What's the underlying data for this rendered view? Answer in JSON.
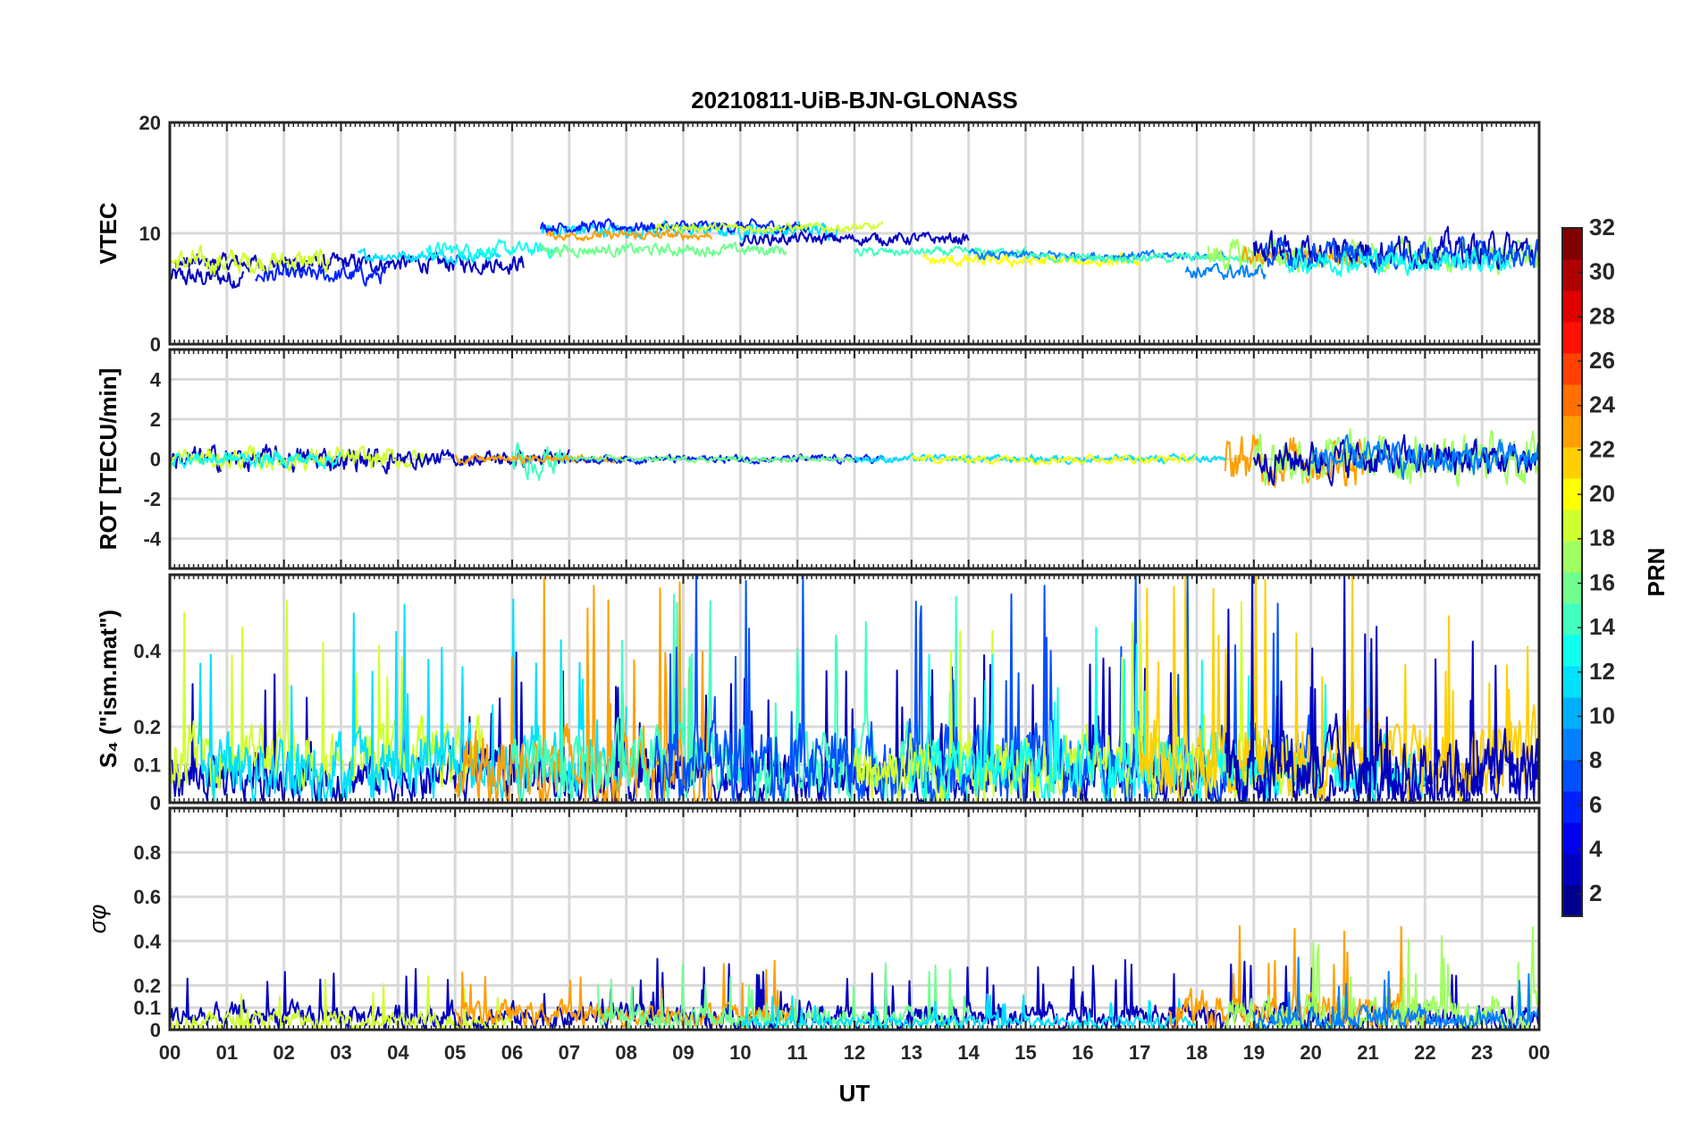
{
  "chart_data": {
    "title": "20210811-UiB-BJN-GLONASS",
    "type": "line",
    "xlabel": "UT",
    "x_tick_labels": [
      "00",
      "01",
      "02",
      "03",
      "04",
      "05",
      "06",
      "07",
      "08",
      "09",
      "10",
      "11",
      "12",
      "13",
      "14",
      "15",
      "16",
      "17",
      "18",
      "19",
      "20",
      "21",
      "22",
      "23",
      "00"
    ],
    "xlim_hours": [
      0,
      24
    ],
    "grid": true,
    "colorbar": {
      "label": "PRN",
      "range": [
        1,
        32
      ],
      "ticks": [
        "2",
        "4",
        "6",
        "8",
        "10",
        "12",
        "14",
        "16",
        "18",
        "20",
        "22",
        "24",
        "26",
        "28",
        "30",
        "32"
      ],
      "colormap": "jet",
      "colors": [
        "#00008f",
        "#0000bf",
        "#0000ef",
        "#0020ff",
        "#0050ff",
        "#0080ff",
        "#00b0ff",
        "#00e0ff",
        "#10ffef",
        "#40ffbf",
        "#70ff8f",
        "#a0ff60",
        "#d0ff30",
        "#ffff00",
        "#ffcf00",
        "#ff9f00",
        "#ff7000",
        "#ff4000",
        "#ff1000",
        "#df0000",
        "#af0000",
        "#800000"
      ]
    },
    "panels": [
      {
        "id": "vtec",
        "ylabel": "VTEC",
        "ylim": [
          0,
          20
        ],
        "yticks": [
          "0",
          "10",
          "20"
        ],
        "segments": [
          {
            "prn": 2,
            "t": [
              0.0,
              1.3
            ],
            "base": 6.0,
            "noise": 0.7
          },
          {
            "prn": 3,
            "t": [
              0.1,
              6.2
            ],
            "base": 7.3,
            "noise": 0.6
          },
          {
            "prn": 19,
            "t": [
              0.0,
              2.8
            ],
            "base": 7.4,
            "noise": 0.8
          },
          {
            "prn": 6,
            "t": [
              1.5,
              3.8
            ],
            "base": 6.2,
            "noise": 0.6
          },
          {
            "prn": 11,
            "t": [
              3.3,
              5.8
            ],
            "base": 8.0,
            "noise": 0.4
          },
          {
            "prn": 13,
            "t": [
              4.5,
              6.8
            ],
            "base": 8.5,
            "noise": 0.5
          },
          {
            "prn": 12,
            "t": [
              6.5,
              11.7
            ],
            "base": 10.3,
            "noise": 0.5
          },
          {
            "prn": 5,
            "t": [
              6.5,
              11.2
            ],
            "base": 10.6,
            "noise": 0.4
          },
          {
            "prn": 16,
            "t": [
              6.5,
              10.8
            ],
            "base": 8.5,
            "noise": 0.4
          },
          {
            "prn": 23,
            "t": [
              6.6,
              9.5
            ],
            "base": 9.8,
            "noise": 0.3
          },
          {
            "prn": 18,
            "t": [
              8.5,
              12.5
            ],
            "base": 10.5,
            "noise": 0.3
          },
          {
            "prn": 2,
            "t": [
              10.0,
              14.0
            ],
            "base": 9.5,
            "noise": 0.4
          },
          {
            "prn": 14,
            "t": [
              12.0,
              15.0
            ],
            "base": 8.3,
            "noise": 0.3
          },
          {
            "prn": 20,
            "t": [
              13.2,
              17.0
            ],
            "base": 7.5,
            "noise": 0.4
          },
          {
            "prn": 8,
            "t": [
              14.0,
              18.5
            ],
            "base": 8.0,
            "noise": 0.3
          },
          {
            "prn": 15,
            "t": [
              15.0,
              19.0
            ],
            "base": 7.8,
            "noise": 0.3
          },
          {
            "prn": 9,
            "t": [
              17.8,
              19.2
            ],
            "base": 6.5,
            "noise": 0.5
          },
          {
            "prn": 17,
            "t": [
              18.2,
              24.0
            ],
            "base": 8.0,
            "noise": 1.0
          },
          {
            "prn": 23,
            "t": [
              18.8,
              21.0
            ],
            "base": 7.8,
            "noise": 0.6
          },
          {
            "prn": 2,
            "t": [
              19.0,
              24.0
            ],
            "base": 8.5,
            "noise": 1.1
          },
          {
            "prn": 7,
            "t": [
              19.2,
              24.0
            ],
            "base": 8.0,
            "noise": 0.9
          },
          {
            "prn": 13,
            "t": [
              19.5,
              23.5
            ],
            "base": 7.5,
            "noise": 0.8
          }
        ]
      },
      {
        "id": "rot",
        "ylabel": "ROT [TECU/min]",
        "ylim": [
          -5.5,
          5.5
        ],
        "yticks": [
          "-4",
          "-2",
          "0",
          "2",
          "4"
        ],
        "segments": [
          {
            "prn": 2,
            "t": [
              0.0,
              4.0
            ],
            "base": 0,
            "noise": 0.45
          },
          {
            "prn": 19,
            "t": [
              0.0,
              4.5
            ],
            "base": 0,
            "noise": 0.4
          },
          {
            "prn": 13,
            "t": [
              0.0,
              3.0
            ],
            "base": 0,
            "noise": 0.3
          },
          {
            "prn": 3,
            "t": [
              4.0,
              7.0
            ],
            "base": 0,
            "noise": 0.3
          },
          {
            "prn": 15,
            "t": [
              6.0,
              7.0
            ],
            "base": 0,
            "noise": 0.6
          },
          {
            "prn": 23,
            "t": [
              5.0,
              8.0
            ],
            "base": 0,
            "noise": 0.15
          },
          {
            "prn": 5,
            "t": [
              7.0,
              12.5
            ],
            "base": 0,
            "noise": 0.15
          },
          {
            "prn": 16,
            "t": [
              7.0,
              12.0
            ],
            "base": 0,
            "noise": 0.1
          },
          {
            "prn": 12,
            "t": [
              12.0,
              18.5
            ],
            "base": 0,
            "noise": 0.15
          },
          {
            "prn": 20,
            "t": [
              13.0,
              18.0
            ],
            "base": 0,
            "noise": 0.15
          },
          {
            "prn": 23,
            "t": [
              18.5,
              21.0
            ],
            "base": 0,
            "noise": 0.9
          },
          {
            "prn": 17,
            "t": [
              19.0,
              24.0
            ],
            "base": 0,
            "noise": 0.9
          },
          {
            "prn": 2,
            "t": [
              19.0,
              24.0
            ],
            "base": 0,
            "noise": 0.7
          },
          {
            "prn": 9,
            "t": [
              20.0,
              24.0
            ],
            "base": 0,
            "noise": 0.6
          }
        ]
      },
      {
        "id": "s4",
        "ylabel": "S₄ (\"ism.mat\")",
        "ylim": [
          0,
          0.6
        ],
        "yticks": [
          "0",
          "0.1",
          "0.2",
          "0.4"
        ],
        "segments": [
          {
            "prn": 2,
            "t": [
              0.0,
              24.0
            ],
            "base": 0.07,
            "noise": 0.05
          },
          {
            "prn": 19,
            "t": [
              0.0,
              5.5
            ],
            "base": 0.13,
            "noise": 0.06
          },
          {
            "prn": 11,
            "t": [
              0.5,
              8.0
            ],
            "base": 0.1,
            "noise": 0.07
          },
          {
            "prn": 23,
            "t": [
              5.0,
              9.5
            ],
            "base": 0.09,
            "noise": 0.08
          },
          {
            "prn": 15,
            "t": [
              6.0,
              14.0
            ],
            "base": 0.09,
            "noise": 0.07
          },
          {
            "prn": 7,
            "t": [
              8.5,
              20.0
            ],
            "base": 0.1,
            "noise": 0.08
          },
          {
            "prn": 18,
            "t": [
              12.0,
              20.0
            ],
            "base": 0.1,
            "noise": 0.07
          },
          {
            "prn": 13,
            "t": [
              13.0,
              22.0
            ],
            "base": 0.09,
            "noise": 0.06
          },
          {
            "prn": 21,
            "t": [
              17.0,
              24.0
            ],
            "base": 0.12,
            "noise": 0.08
          },
          {
            "prn": 3,
            "t": [
              18.5,
              24.0
            ],
            "base": 0.09,
            "noise": 0.08
          }
        ]
      },
      {
        "id": "sigma",
        "ylabel": "σφ",
        "ylim": [
          0,
          1.0
        ],
        "yticks": [
          "0",
          "0.1",
          "0.2",
          "0.4",
          "0.6",
          "0.8"
        ],
        "segments": [
          {
            "prn": 2,
            "t": [
              0.0,
              24.0
            ],
            "base": 0.06,
            "noise": 0.04
          },
          {
            "prn": 19,
            "t": [
              0.0,
              6.0
            ],
            "base": 0.04,
            "noise": 0.03
          },
          {
            "prn": 23,
            "t": [
              5.0,
              11.0
            ],
            "base": 0.07,
            "noise": 0.04
          },
          {
            "prn": 16,
            "t": [
              7.5,
              14.0
            ],
            "base": 0.05,
            "noise": 0.04
          },
          {
            "prn": 12,
            "t": [
              10.0,
              18.0
            ],
            "base": 0.03,
            "noise": 0.02
          },
          {
            "prn": 23,
            "t": [
              17.5,
              22.0
            ],
            "base": 0.08,
            "noise": 0.06
          },
          {
            "prn": 17,
            "t": [
              18.5,
              24.0
            ],
            "base": 0.07,
            "noise": 0.06
          },
          {
            "prn": 9,
            "t": [
              19.0,
              24.0
            ],
            "base": 0.05,
            "noise": 0.04
          }
        ]
      }
    ]
  }
}
